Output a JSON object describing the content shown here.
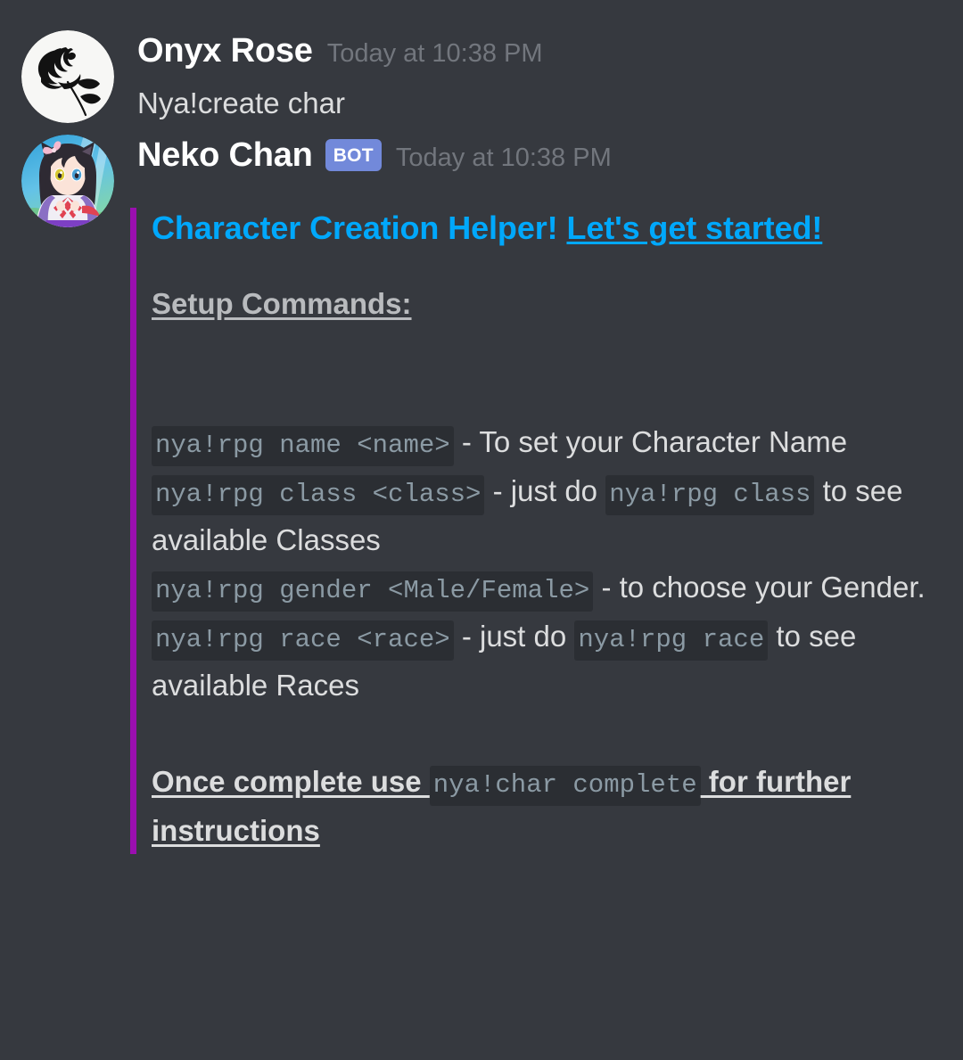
{
  "theme": {
    "background": "#36393f",
    "code_background": "#2b2e33",
    "code_text": "#8b9aa4",
    "body_text": "#dcddde",
    "muted_text": "#72767d",
    "embed_title": "#00a8fc",
    "embed_bar": "#9b0fb0",
    "bot_badge_bg": "#7289da"
  },
  "messages": [
    {
      "author": "Onyx Rose",
      "timestamp": "Today at 10:38 PM",
      "is_bot": false,
      "avatar_name": "black-rose-avatar",
      "text": "Nya!create char"
    },
    {
      "author": "Neko Chan",
      "bot_label": "BOT",
      "timestamp": "Today at 10:38 PM",
      "is_bot": true,
      "avatar_name": "neko-chan-avatar"
    }
  ],
  "embed": {
    "title_plain": "Character Creation Helper! ",
    "title_underlined": "Let's get started!",
    "subtitle": "Setup Commands:",
    "commands": [
      {
        "code": "nya!rpg name <name>",
        "desc": " - To set your Character Name"
      },
      {
        "code": "nya!rpg class <class>",
        "desc_before": " - just do ",
        "code2": "nya!rpg class",
        "desc_after": " to see available Classes"
      },
      {
        "code": "nya!rpg gender <Male/Female>",
        "desc": " - to choose your Gender."
      },
      {
        "code": "nya!rpg race <race>",
        "desc_before": " - just do ",
        "code2": "nya!rpg race",
        "desc_after": " to see available Races"
      }
    ],
    "footer": {
      "before": "Once complete use ",
      "code": "nya!char complete",
      "after": " for further instructions"
    }
  }
}
